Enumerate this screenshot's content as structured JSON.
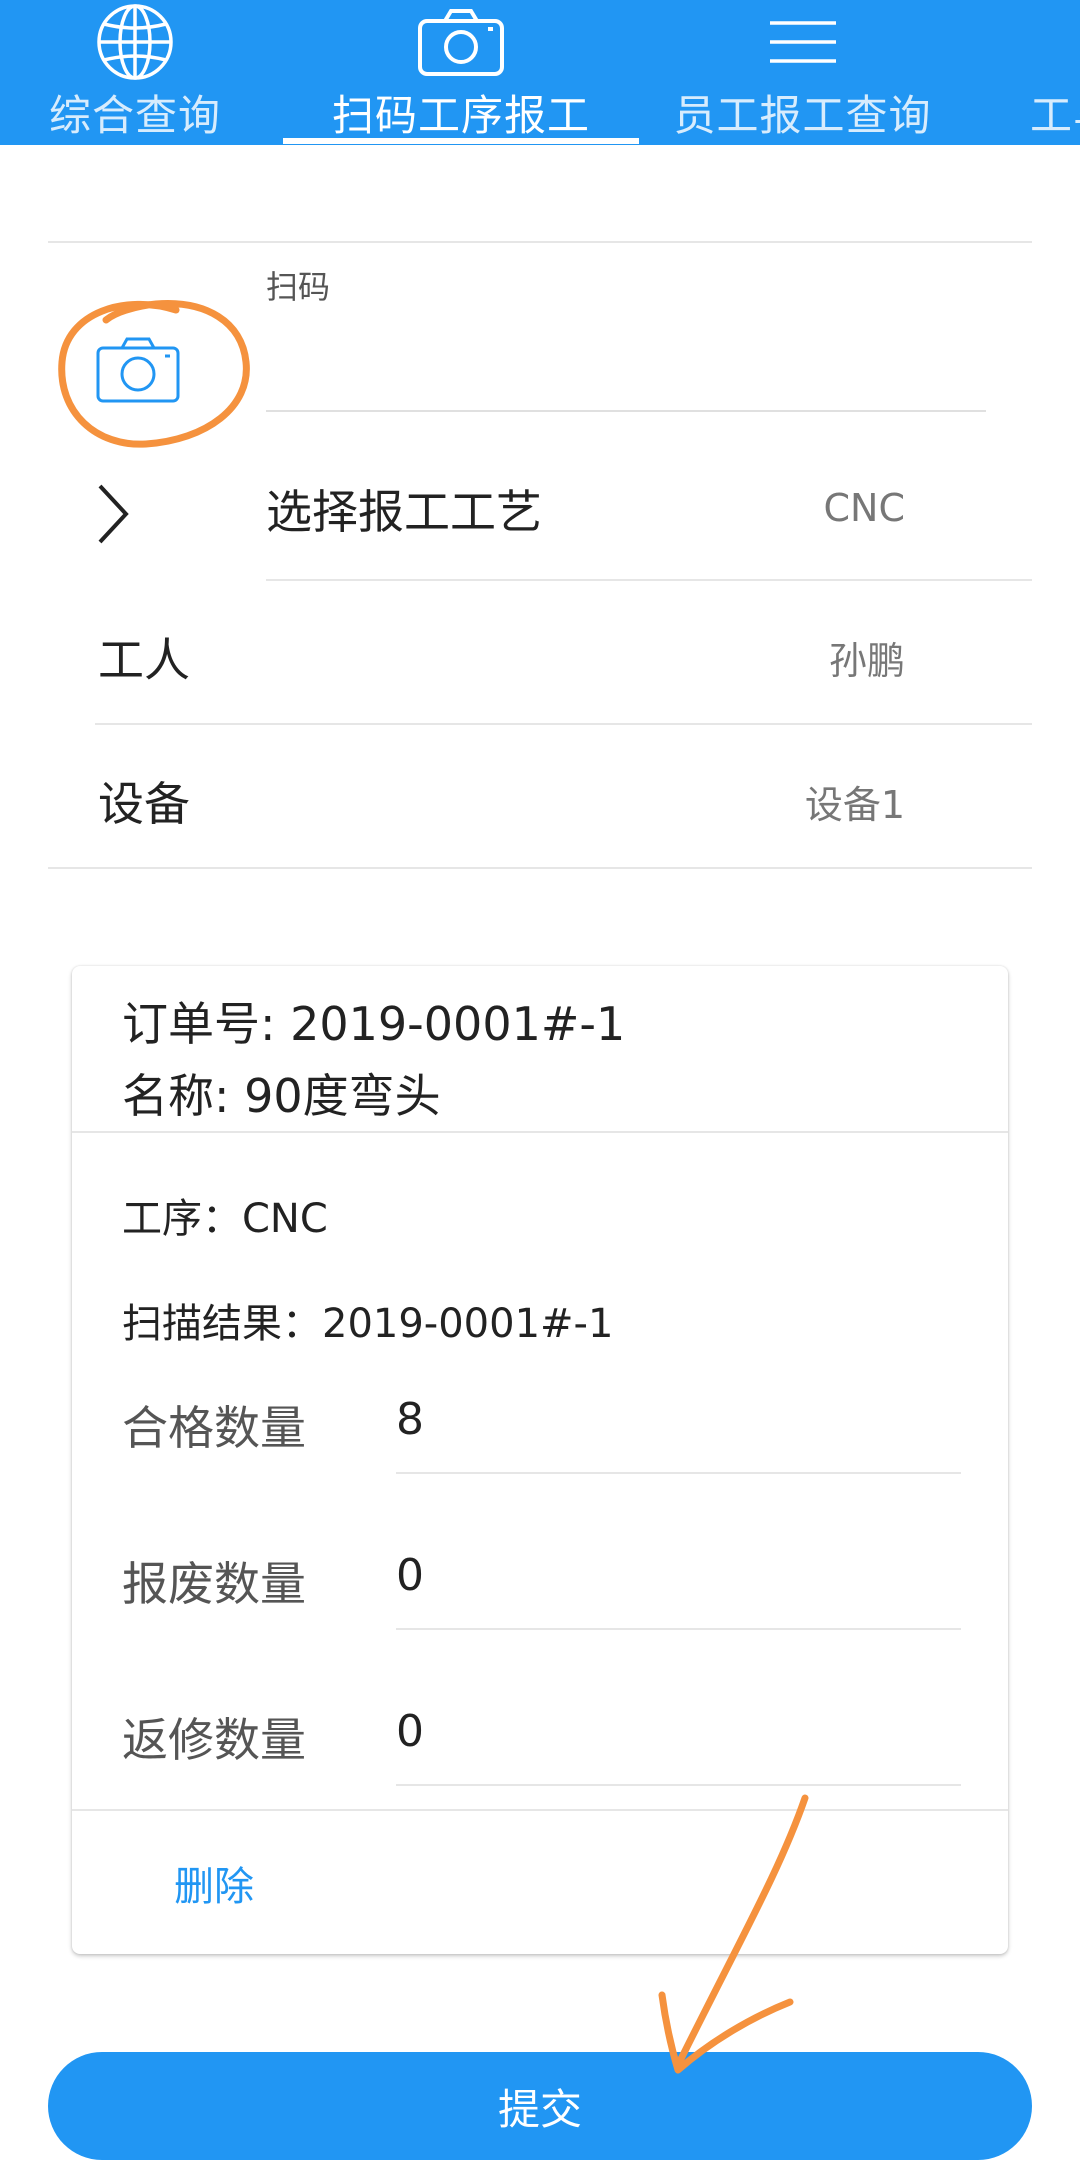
{
  "tabs": [
    {
      "label": "综合查询",
      "icon": "globe-icon"
    },
    {
      "label": "扫码工序报工",
      "icon": "camera-icon",
      "active": true
    },
    {
      "label": "员工报工查询",
      "icon": "menu-icon"
    },
    {
      "label": "工与",
      "icon": "clock-icon"
    }
  ],
  "form": {
    "scan_label": "扫码",
    "process_label": "选择报工工艺",
    "process_value": "CNC",
    "worker_label": "工人",
    "worker_value": "孙鹏",
    "device_label": "设备",
    "device_value": "设备1"
  },
  "card": {
    "order_line": "订单号: 2019-0001#-1",
    "name_line": "名称: 90度弯头",
    "process_line": "工序：CNC",
    "scan_result_line": "扫描结果：2019-0001#-1",
    "qualified_label": "合格数量",
    "qualified_value": "8",
    "scrap_label": "报废数量",
    "scrap_value": "0",
    "rework_label": "返修数量",
    "rework_value": "0",
    "delete_label": "删除"
  },
  "submit_label": "提交",
  "colors": {
    "primary": "#2196f3",
    "annotation": "#f5923e"
  }
}
